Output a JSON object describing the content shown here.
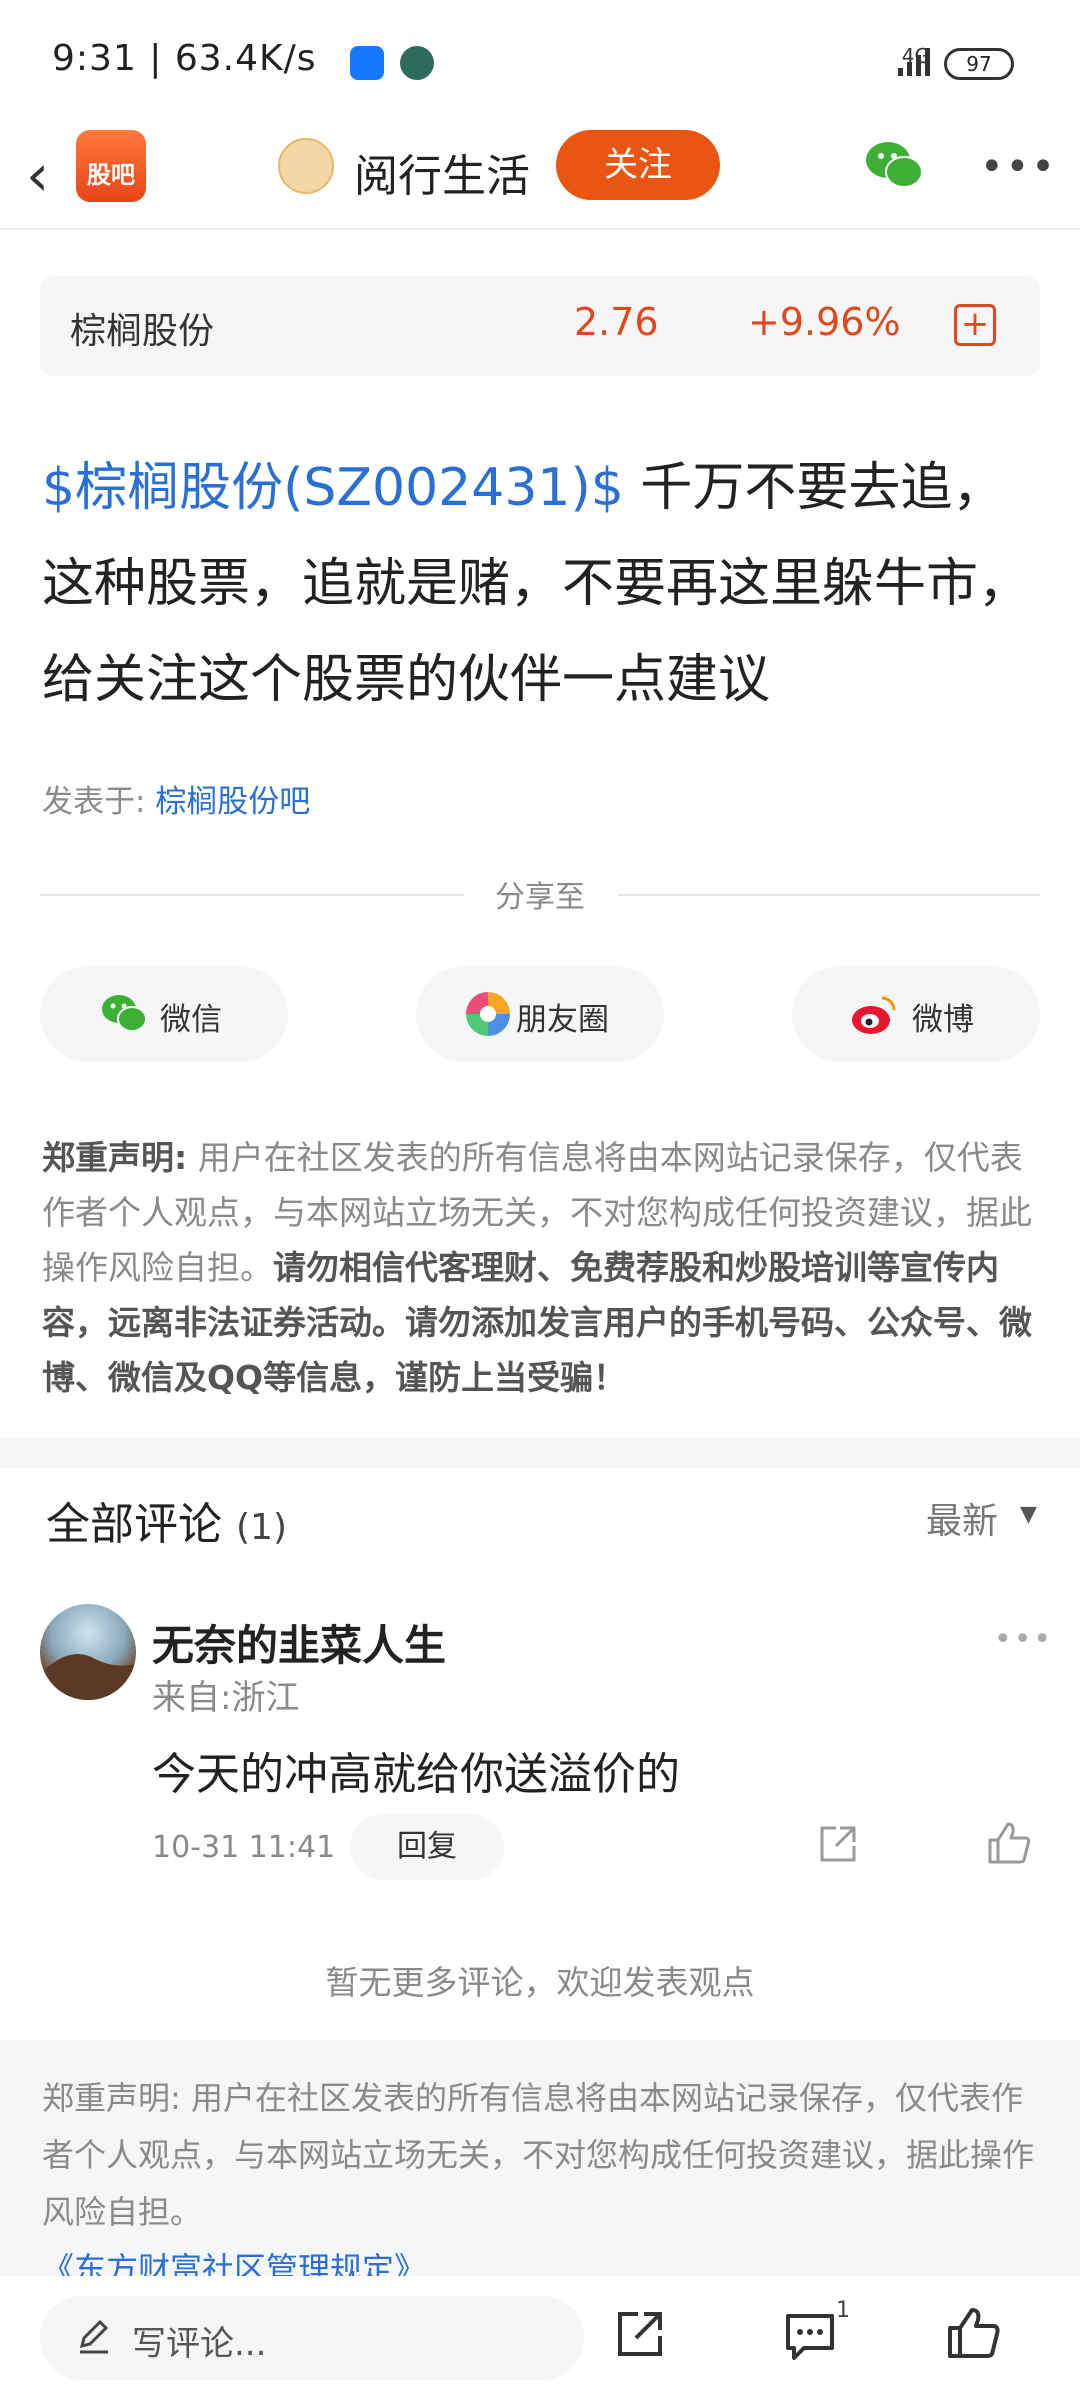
{
  "status_bar": {
    "time_speed": "9:31 | 63.4K/s",
    "network": "4G",
    "battery": "97"
  },
  "nav": {
    "logo_text": "股吧",
    "title": "阅行生活",
    "follow_label": "关注"
  },
  "stock": {
    "name": "棕榈股份",
    "price": "2.76",
    "change": "+9.96%",
    "add_symbol": "+"
  },
  "post": {
    "tag": "$棕榈股份(SZ002431)$",
    "text": " 千万不要去追，这种股票，追就是赌，不要再这里躲牛市，给关注这个股票的伙伴一点建议"
  },
  "posted_in": {
    "label": "发表于:",
    "forum": "棕榈股份吧"
  },
  "share": {
    "label": "分享至",
    "buttons": [
      {
        "label": "微信",
        "icon": "wechat-icon"
      },
      {
        "label": "朋友圈",
        "icon": "moments-icon"
      },
      {
        "label": "微博",
        "icon": "weibo-icon"
      }
    ]
  },
  "disclaimer": {
    "title": "郑重声明:",
    "normal": " 用户在社区发表的所有信息将由本网站记录保存，仅代表作者个人观点，与本网站立场无关，不对您构成任何投资建议，据此操作风险自担。",
    "bold": "请勿相信代客理财、免费荐股和炒股培训等宣传内容，远离非法证券活动。请勿添加发言用户的手机号码、公众号、微博、微信及QQ等信息，谨防上当受骗！"
  },
  "comments": {
    "title": "全部评论",
    "count": "(1)",
    "sort_label": "最新",
    "items": [
      {
        "user": "无奈的韭菜人生",
        "from": "来自:浙江",
        "text": "今天的冲高就给你送溢价的",
        "time": "10-31 11:41",
        "reply_label": "回复"
      }
    ],
    "no_more": "暂无更多评论，欢迎发表观点"
  },
  "footer": {
    "text": "郑重声明: 用户在社区发表的所有信息将由本网站记录保存，仅代表作者个人观点，与本网站立场无关，不对您构成任何投资建议，据此操作风险自担。",
    "link": "《东方财富社区管理规定》"
  },
  "bottom_bar": {
    "write_placeholder": "写评论...",
    "comment_count": "1"
  },
  "colors": {
    "accent": "#ea5514",
    "up_red": "#e0481f",
    "link_blue": "#2a6fd6"
  }
}
